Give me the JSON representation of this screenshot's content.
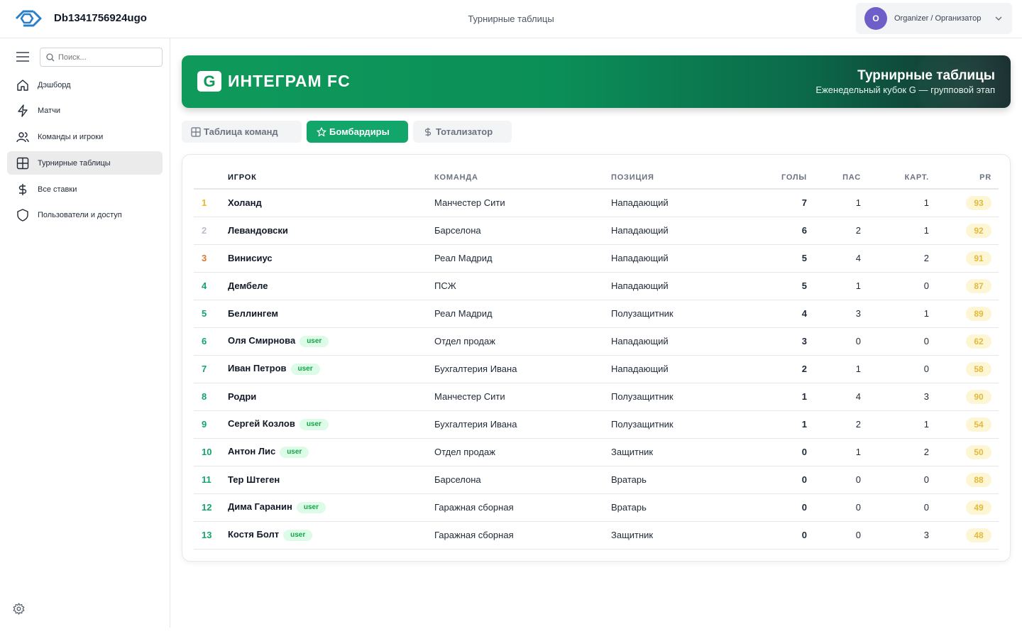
{
  "app": {
    "title": "Db1341756924ugo",
    "section_title": "Турнирные таблицы"
  },
  "user": {
    "initial": "O",
    "name": "Organizer / Организатор"
  },
  "search": {
    "placeholder": "Поиск..."
  },
  "nav": [
    {
      "label": "Дэшборд",
      "icon": "home-icon"
    },
    {
      "label": "Матчи",
      "icon": "lightning-icon"
    },
    {
      "label": "Команды и игроки",
      "icon": "users-icon"
    },
    {
      "label": "Турнирные таблицы",
      "icon": "grid-icon",
      "active": true
    },
    {
      "label": "Все ставки",
      "icon": "dollar-icon"
    },
    {
      "label": "Пользователи и доступ",
      "icon": "shield-icon"
    }
  ],
  "banner": {
    "badge": "G",
    "brand": "ИНТЕГРАМ FC",
    "title": "Турнирные таблицы",
    "subtitle": "Еженедельный кубок G — групповой этап"
  },
  "tabs": [
    {
      "label": "Таблица команд",
      "icon": "table-icon"
    },
    {
      "label": "Бомбардиры",
      "icon": "star-icon",
      "active": true
    },
    {
      "label": "Тотализатор",
      "icon": "dollar-icon"
    }
  ],
  "table": {
    "headers": [
      "ИГРОК",
      "КОМАНДА",
      "ПОЗИЦИЯ",
      "ГОЛЫ",
      "ПАС",
      "КАРТ.",
      "PR"
    ],
    "rows": [
      {
        "rank": "1",
        "player": "Холанд",
        "tag": "",
        "team": "Манчестер Сити",
        "pos": "Нападающий",
        "goals": "7",
        "assists": "1",
        "cards": "1",
        "pr": "93"
      },
      {
        "rank": "2",
        "player": "Левандовски",
        "tag": "",
        "team": "Барселона",
        "pos": "Нападающий",
        "goals": "6",
        "assists": "2",
        "cards": "1",
        "pr": "92"
      },
      {
        "rank": "3",
        "player": "Винисиус",
        "tag": "",
        "team": "Реал Мадрид",
        "pos": "Нападающий",
        "goals": "5",
        "assists": "4",
        "cards": "2",
        "pr": "91"
      },
      {
        "rank": "4",
        "player": "Дембеле",
        "tag": "",
        "team": "ПСЖ",
        "pos": "Нападающий",
        "goals": "5",
        "assists": "1",
        "cards": "0",
        "pr": "87"
      },
      {
        "rank": "5",
        "player": "Беллингем",
        "tag": "",
        "team": "Реал Мадрид",
        "pos": "Полузащитник",
        "goals": "4",
        "assists": "3",
        "cards": "1",
        "pr": "89"
      },
      {
        "rank": "6",
        "player": "Оля Смирнова",
        "tag": "user",
        "team": "Отдел продаж",
        "pos": "Нападающий",
        "goals": "3",
        "assists": "0",
        "cards": "0",
        "pr": "62"
      },
      {
        "rank": "7",
        "player": "Иван Петров",
        "tag": "user",
        "team": "Бухгалтерия Ивана",
        "pos": "Нападающий",
        "goals": "2",
        "assists": "1",
        "cards": "0",
        "pr": "58"
      },
      {
        "rank": "8",
        "player": "Родри",
        "tag": "",
        "team": "Манчестер Сити",
        "pos": "Полузащитник",
        "goals": "1",
        "assists": "4",
        "cards": "3",
        "pr": "90"
      },
      {
        "rank": "9",
        "player": "Сергей Козлов",
        "tag": "user",
        "team": "Бухгалтерия Ивана",
        "pos": "Полузащитник",
        "goals": "1",
        "assists": "2",
        "cards": "1",
        "pr": "54"
      },
      {
        "rank": "10",
        "player": "Антон Лис",
        "tag": "user",
        "team": "Отдел продаж",
        "pos": "Защитник",
        "goals": "0",
        "assists": "1",
        "cards": "2",
        "pr": "50"
      },
      {
        "rank": "11",
        "player": "Тер Штеген",
        "tag": "",
        "team": "Барселона",
        "pos": "Вратарь",
        "goals": "0",
        "assists": "0",
        "cards": "0",
        "pr": "88"
      },
      {
        "rank": "12",
        "player": "Дима Гаранин",
        "tag": "user",
        "team": "Гаражная сборная",
        "pos": "Вратарь",
        "goals": "0",
        "assists": "0",
        "cards": "0",
        "pr": "49"
      },
      {
        "rank": "13",
        "player": "Костя Болт",
        "tag": "user",
        "team": "Гаражная сборная",
        "pos": "Защитник",
        "goals": "0",
        "assists": "0",
        "cards": "3",
        "pr": "48"
      }
    ]
  },
  "colors": {
    "accent": "#12a66a",
    "gold": "#f0b429",
    "silver": "#b6c0cc",
    "bronze": "#d97a34",
    "pr_badge_bg": "#fdf6d5",
    "pr_badge_text": "#e3b93c"
  }
}
